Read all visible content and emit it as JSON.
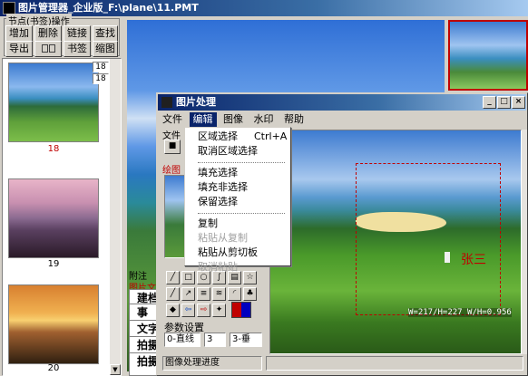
{
  "main": {
    "title": "图片管理器_企业版_F:\\plane\\11.PMT"
  },
  "nodes": {
    "group": "节点(书签)操作",
    "buttons": [
      "增加",
      "删除",
      "链接",
      "查找",
      "导出",
      "书签",
      "缩图"
    ],
    "spin": [
      "18",
      "18"
    ]
  },
  "thumbs": {
    "captions": [
      "18",
      "19",
      "20"
    ]
  },
  "dialog": {
    "title": "图片处理",
    "menu": [
      "文件",
      "编辑",
      "图像",
      "水印",
      "帮助"
    ],
    "side_labels": {
      "file": "文件",
      "draw": "绘图"
    },
    "edit_menu": {
      "items": [
        "区域选择",
        "取消区域选择",
        "填充选择",
        "填充非选择",
        "保留选择",
        "复制",
        "粘贴从复制",
        "粘贴从剪切板",
        "取消粘贴"
      ],
      "shortcut": "Ctrl+A"
    },
    "params": {
      "label": "参数设置",
      "selects": [
        "0-直线",
        "3",
        "3-垂"
      ]
    },
    "status": "图像处理进度",
    "watermark": "张三",
    "coords": "W=217/H=227 W/H=0.956"
  },
  "bottom_left": {
    "tab": "附注",
    "sublabel": "图片文",
    "rows": [
      "建档",
      "事",
      "文字",
      "拍摄",
      "拍摄"
    ]
  },
  "colors": {
    "title_dark": "#0a246a",
    "red_mark": "#c00000",
    "accent_blue": "#3a6ea5"
  }
}
